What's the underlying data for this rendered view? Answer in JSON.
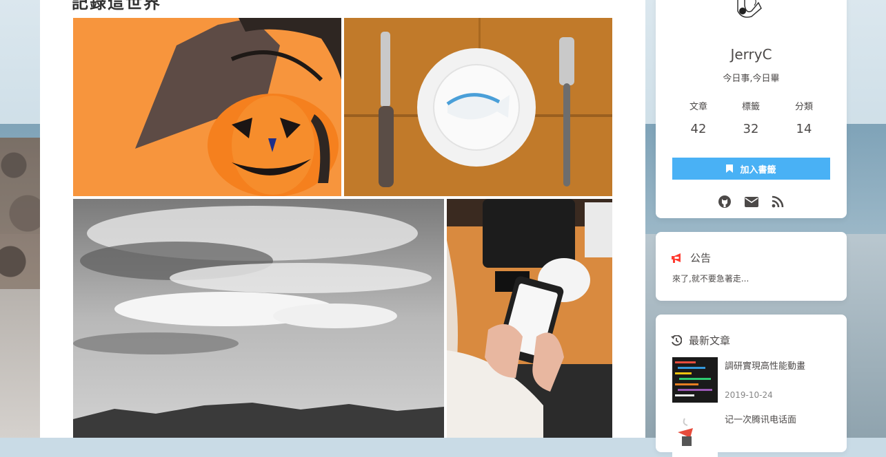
{
  "post": {
    "title": "記錄這世界"
  },
  "author": {
    "name": "JerryC",
    "description": "今日事,今日畢",
    "stats": [
      {
        "label": "文章",
        "value": "42"
      },
      {
        "label": "標籤",
        "value": "32"
      },
      {
        "label": "分類",
        "value": "14"
      }
    ],
    "bookmark_label": "加入書籤",
    "social_icons": [
      "github-icon",
      "email-icon",
      "rss-icon"
    ]
  },
  "notice": {
    "title": "公告",
    "text": "來了,就不要急著走..."
  },
  "recent": {
    "title": "最新文章",
    "items": [
      {
        "title": "調研實現高性能動畫",
        "date": "2019-10-24"
      },
      {
        "title": "记一次腾讯电话面",
        "date": ""
      }
    ]
  },
  "colors": {
    "accent": "#49b1f5",
    "text": "#4c4948",
    "megaphone": "#ff3b30"
  }
}
